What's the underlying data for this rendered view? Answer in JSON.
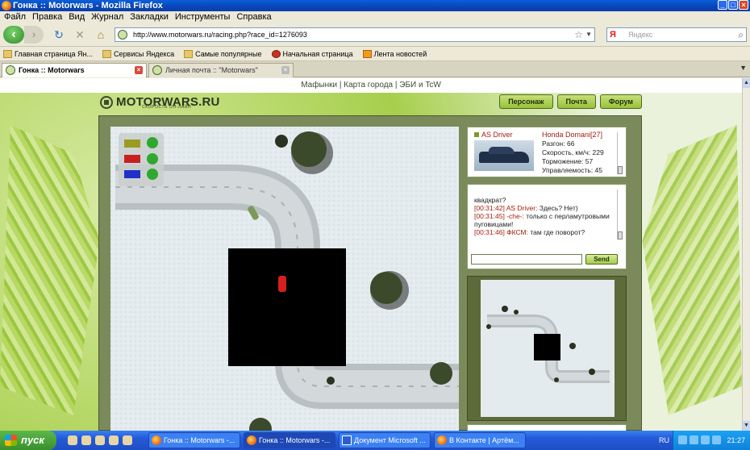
{
  "window": {
    "title": "Гонка :: Motorwars - Mozilla Firefox"
  },
  "menu": [
    "Файл",
    "Правка",
    "Вид",
    "Журнал",
    "Закладки",
    "Инструменты",
    "Справка"
  ],
  "nav": {
    "url": "http://www.motorwars.ru/racing.php?race_id=1276093",
    "search_placeholder": "Яндекс",
    "search_engine_logo": "Я"
  },
  "bookmarks": [
    "Главная страница Ян...",
    "Сервисы Яндекса",
    "Самые популярные",
    "Начальная страница",
    "Лента новостей"
  ],
  "tabs": [
    {
      "label": "Гонка :: Motorwars",
      "active": true
    },
    {
      "label": "Личная почта :: \"Motorwars\"",
      "active": false
    }
  ],
  "site": {
    "top_links": "Мафынки | Карта города | ЭБИ и TcW",
    "logo_text": "MOTORWARS.RU",
    "logo_sub": "СКОРОСТЬ ОН-ЛАЙН",
    "buttons": [
      "Персонаж",
      "Почта",
      "Форум"
    ]
  },
  "car_card": {
    "driver": "AS Driver",
    "car": "Honda Domani[27]",
    "stats": [
      "Разгон: 66",
      "Скорость, км/ч: 229",
      "Торможение: 57",
      "Управляемость: 45"
    ]
  },
  "chat": {
    "lines": [
      {
        "time": "",
        "nick": "",
        "text": "квадкрат?"
      },
      {
        "time": "[00:31:42]",
        "nick": "AS Driver:",
        "text": "Здесь? Нет)"
      },
      {
        "time": "[00:31:45]",
        "nick": "-che-:",
        "text": "только с перламутровыми пуговицами!"
      },
      {
        "time": "[00:31:46]",
        "nick": "ФКСМ:",
        "text": "там где поворот?"
      }
    ],
    "send_label": "Send"
  },
  "taskbar": {
    "start_label": "пуск",
    "tasks": [
      {
        "label": "Гонка :: Motorwars -...",
        "active": false
      },
      {
        "label": "Гонка :: Motorwars -...",
        "active": true
      },
      {
        "label": "Документ Microsoft ...",
        "active": false
      },
      {
        "label": "В Контакте | Артём...",
        "active": false
      }
    ],
    "lang": "RU",
    "clock": "21:27"
  }
}
